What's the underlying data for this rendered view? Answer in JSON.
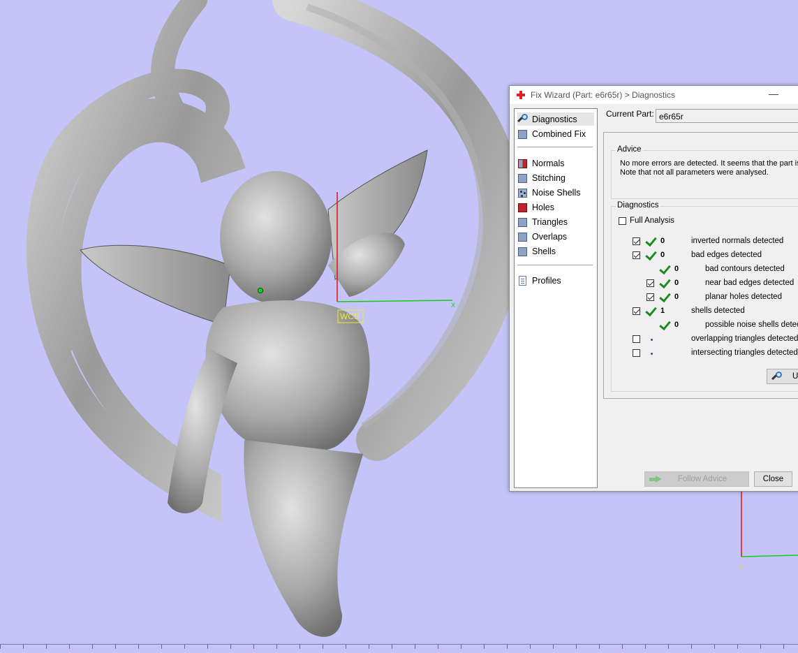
{
  "viewport": {
    "wcs_label": "WCS",
    "x_axis_label": "X",
    "y_axis_label": "Y",
    "background_color": "#c4c4f8"
  },
  "dialog": {
    "title": "Fix Wizard (Part: e6r65r) > Diagnostics",
    "minimize_symbol": "—",
    "nav_items": [
      {
        "label": "Diagnostics",
        "icon": "magnifier-icon"
      },
      {
        "label": "Combined Fix",
        "icon": "cube-icon"
      },
      {
        "label": "Normals",
        "icon": "normals-cube-icon"
      },
      {
        "label": "Stitching",
        "icon": "cube-icon"
      },
      {
        "label": "Noise Shells",
        "icon": "noise-shells-icon"
      },
      {
        "label": "Holes",
        "icon": "holes-cube-icon"
      },
      {
        "label": "Triangles",
        "icon": "cube-icon"
      },
      {
        "label": "Overlaps",
        "icon": "cube-icon"
      },
      {
        "label": "Shells",
        "icon": "cube-icon"
      },
      {
        "label": "Profiles",
        "icon": "document-icon"
      }
    ],
    "current_part_label": "Current Part:",
    "current_part_value": "e6r65r",
    "advice": {
      "legend": "Advice",
      "line1": "No more errors are detected. It seems that the part is",
      "line2": "Note that not all parameters were analysed."
    },
    "diagnostics": {
      "legend": "Diagnostics",
      "full_analysis_label": "Full Analysis",
      "rows": [
        {
          "count": "0",
          "label": "inverted normals detected",
          "checked": true
        },
        {
          "count": "0",
          "label": "bad edges detected",
          "checked": true
        },
        {
          "count": "0",
          "label": "bad contours detected",
          "checked": false
        },
        {
          "count": "0",
          "label": "near bad edges detected",
          "checked": true
        },
        {
          "count": "0",
          "label": "planar holes detected",
          "checked": true
        },
        {
          "count": "1",
          "label": "shells detected",
          "checked": true
        },
        {
          "count": "0",
          "label": "possible noise shells detected",
          "checked": false
        },
        {
          "count": "",
          "label": "overlapping triangles detected",
          "checked": false
        },
        {
          "count": "",
          "label": "intersecting triangles detected",
          "checked": false
        }
      ],
      "update_button_label": "U"
    },
    "follow_advice_label": "Follow Advice",
    "close_label": "Close"
  }
}
